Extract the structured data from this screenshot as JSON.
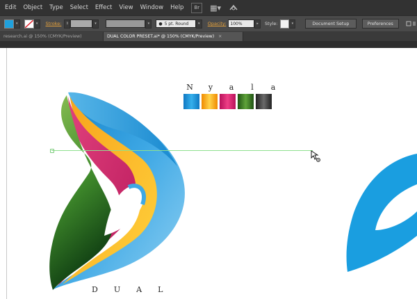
{
  "menu": {
    "items": [
      "Edit",
      "Object",
      "Type",
      "Select",
      "Effect",
      "View",
      "Window",
      "Help"
    ],
    "bridge_btn": "Br",
    "arrange_btn": "▦▾"
  },
  "control": {
    "fill_color": "#1fa1dd",
    "stroke_label": "Stroke:",
    "brush_label": "5 pt. Round",
    "opacity_label": "Opacity:",
    "opacity_value": "100%",
    "style_label": "Style:",
    "doc_setup": "Document Setup",
    "preferences": "Preferences"
  },
  "tabs": [
    {
      "label": "research.ai @ 150% (CMYK/Preview)"
    },
    {
      "label": "DUAL COLOR PRESET.ai* @ 150% (CMYK/Preview)",
      "close": "×"
    }
  ],
  "artwork": {
    "brand_letters": [
      "N",
      "y",
      "a",
      "l",
      "a"
    ],
    "swatches": [
      {
        "name": "blue",
        "color": "#1f9ad6"
      },
      {
        "name": "yellow",
        "color": "#f5b800"
      },
      {
        "name": "magenta",
        "color": "#d81f6c"
      },
      {
        "name": "green",
        "color": "#3d7a25"
      },
      {
        "name": "gray",
        "color": "#4a4a4a"
      }
    ],
    "dual_letters": [
      "D",
      "U",
      "A",
      "L"
    ]
  }
}
